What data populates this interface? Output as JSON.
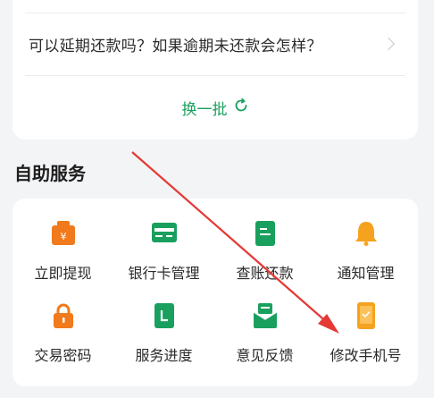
{
  "faq": {
    "question": "可以延期还款吗？如果逾期未还款会怎样？",
    "refresh_label": "换一批"
  },
  "self_service": {
    "title": "自助服务",
    "items": [
      {
        "label": "立即提现",
        "icon": "yuan-bag-icon"
      },
      {
        "label": "银行卡管理",
        "icon": "bank-card-icon"
      },
      {
        "label": "查账还款",
        "icon": "bill-document-icon"
      },
      {
        "label": "通知管理",
        "icon": "bell-icon"
      },
      {
        "label": "交易密码",
        "icon": "lock-icon"
      },
      {
        "label": "服务进度",
        "icon": "progress-document-icon"
      },
      {
        "label": "意见反馈",
        "icon": "feedback-mail-icon"
      },
      {
        "label": "修改手机号",
        "icon": "phone-icon"
      }
    ]
  },
  "colors": {
    "accent_green": "#1aa05e",
    "orange": "#f07a1c",
    "arrow_red": "#e53935"
  }
}
